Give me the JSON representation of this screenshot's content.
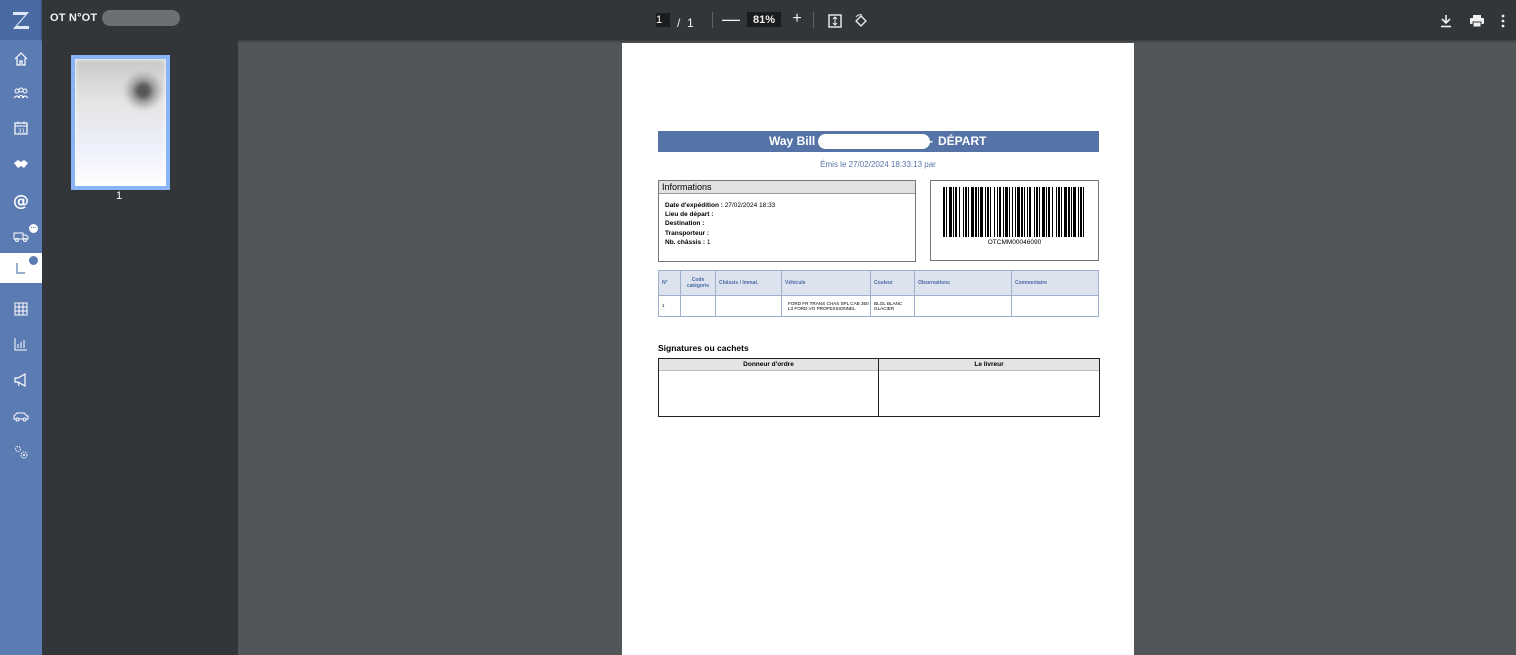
{
  "sidebar": {
    "items": [
      {
        "name": "home-icon"
      },
      {
        "name": "people-icon"
      },
      {
        "name": "calendar-icon"
      },
      {
        "name": "handshake-icon"
      },
      {
        "name": "at-icon"
      },
      {
        "name": "truck-icon"
      },
      {
        "name": "document-icon"
      },
      {
        "name": "table-icon"
      },
      {
        "name": "chart-icon"
      },
      {
        "name": "megaphone-icon"
      },
      {
        "name": "car-icon"
      },
      {
        "name": "settings-icon"
      }
    ]
  },
  "toolbar": {
    "title": "OT N°OT",
    "current_page": "1",
    "page_separator": "/",
    "total_pages": "1",
    "zoom_out": "—",
    "zoom": "81%",
    "zoom_in": "+"
  },
  "thumbnails": {
    "page_number": "1"
  },
  "document": {
    "header_title": "Way Bill",
    "header_dash": "-",
    "header_suffix": "DÉPART",
    "issued": "Émis le 27/02/2024 18:33:13 par",
    "info": {
      "heading": "Informations",
      "ship_date_label": "Date d'expédition :",
      "ship_date": " 27/02/2024 18:33",
      "departure_label": "Lieu de départ :",
      "destination_label": "Destination :",
      "carrier_label": "Transporteur :",
      "chassis_count_label": "Nb. châssis :",
      "chassis_count": " 1"
    },
    "barcode_text": "OTCMM00046090",
    "table": {
      "headers": [
        "N°",
        "Code catégorie",
        "Châssis / Immat.",
        "Véhicule",
        "Couleur",
        "Observations",
        "Commentaire"
      ],
      "rows": [
        [
          "1",
          "",
          "",
          "FORD FR TRANS CHAS SPL CAB 350 L3 FORD VO PROFESSIONNEL",
          "BLGL BLANC GLACIER",
          "",
          ""
        ]
      ]
    },
    "signatures": {
      "title": "Signatures ou cachets",
      "left": "Donneur d'ordre",
      "right": "Le livreur"
    }
  }
}
